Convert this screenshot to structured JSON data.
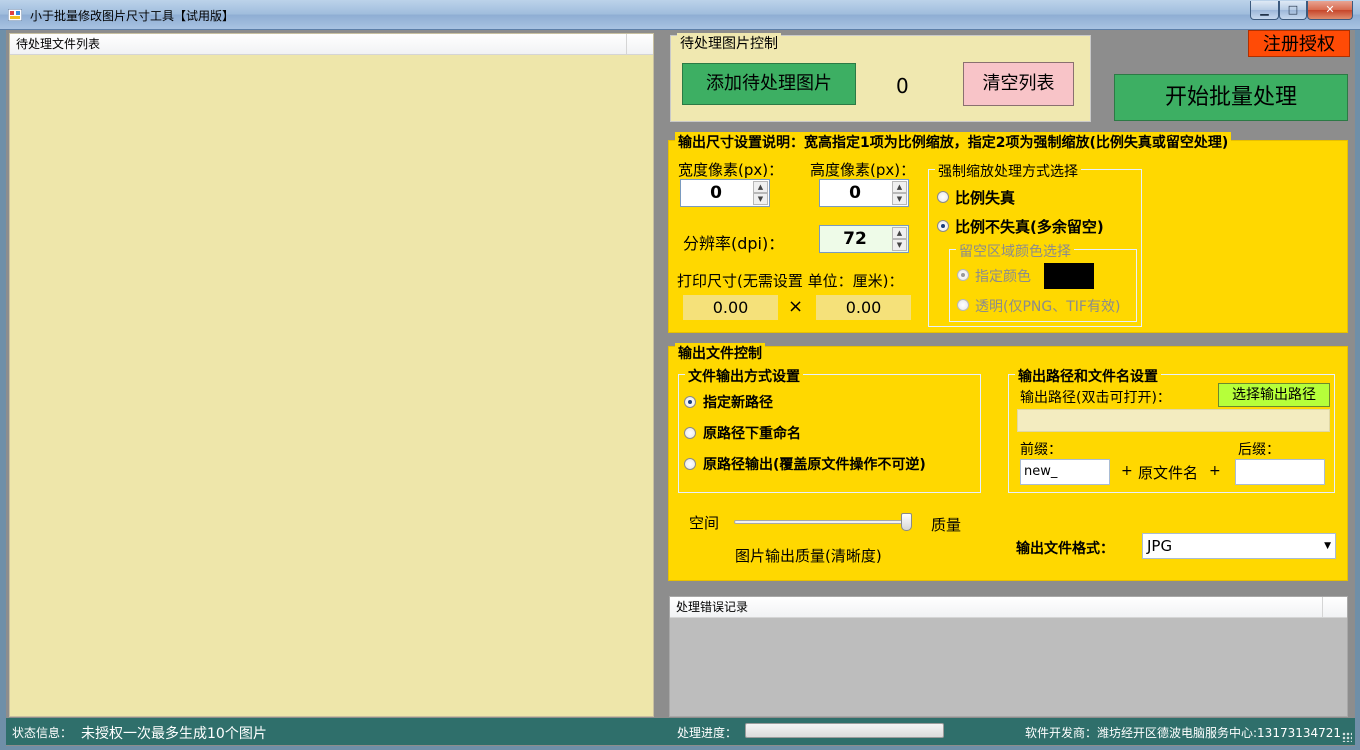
{
  "window": {
    "title": "小于批量修改图片尺寸工具【试用版】",
    "controls": {
      "minimize": "▁",
      "maximize": "□",
      "close": "✕"
    }
  },
  "file_list": {
    "header": "待处理文件列表"
  },
  "image_control": {
    "title": "待处理图片控制",
    "add_label": "添加待处理图片",
    "count": "0",
    "clear_label": "清空列表"
  },
  "register_label": "注册授权",
  "start_label": "开始批量处理",
  "size_settings": {
    "title": "输出尺寸设置说明：宽高指定1项为比例缩放，指定2项为强制缩放(比例失真或留空处理)",
    "width_label": "宽度像素(px)：",
    "width_value": "0",
    "height_label": "高度像素(px)：",
    "height_value": "0",
    "dpi_label": "分辨率(dpi)：",
    "dpi_value": "72",
    "print_label": "打印尺寸(无需设置 单位：厘米)：",
    "print_width": "0.00",
    "print_sep": "×",
    "print_height": "0.00",
    "scale_mode": {
      "title": "强制缩放处理方式选择",
      "options": [
        {
          "label": "比例失真",
          "selected": false
        },
        {
          "label": "比例不失真(多余留空)",
          "selected": true
        }
      ],
      "fill": {
        "title": "留空区域颜色选择",
        "options": [
          {
            "label": "指定颜色",
            "selected": true
          },
          {
            "label": "透明(仅PNG、TIF有效)",
            "selected": false
          }
        ],
        "color": "#000000"
      }
    }
  },
  "output": {
    "title": "输出文件控制",
    "mode": {
      "title": "文件输出方式设置",
      "options": [
        {
          "label": "指定新路径",
          "selected": true
        },
        {
          "label": "原路径下重命名",
          "selected": false
        },
        {
          "label": "原路径输出(覆盖原文件操作不可逆)",
          "selected": false
        }
      ]
    },
    "path": {
      "title": "输出路径和文件名设置",
      "path_label": "输出路径(双击可打开)：",
      "choose_label": "选择输出路径",
      "path_value": "",
      "prefix_label": "前缀：",
      "suffix_label": "后缀：",
      "prefix_value": "new_",
      "plus1": "+",
      "filename_label": "原文件名",
      "plus2": "+",
      "suffix_value": ""
    },
    "quality": {
      "left_label": "空间",
      "right_label": "质量",
      "caption": "图片输出质量(清晰度)",
      "value": 1.0
    },
    "format_label": "输出文件格式：",
    "format_value": "JPG"
  },
  "error_log": {
    "header": "处理错误记录"
  },
  "status": {
    "info_label": "状态信息：",
    "info_value": "未授权一次最多生成10个图片",
    "progress_label": "处理进度：",
    "progress": 0,
    "developer": "软件开发商：潍坊经开区德波电脑服务中心:13173134721"
  }
}
